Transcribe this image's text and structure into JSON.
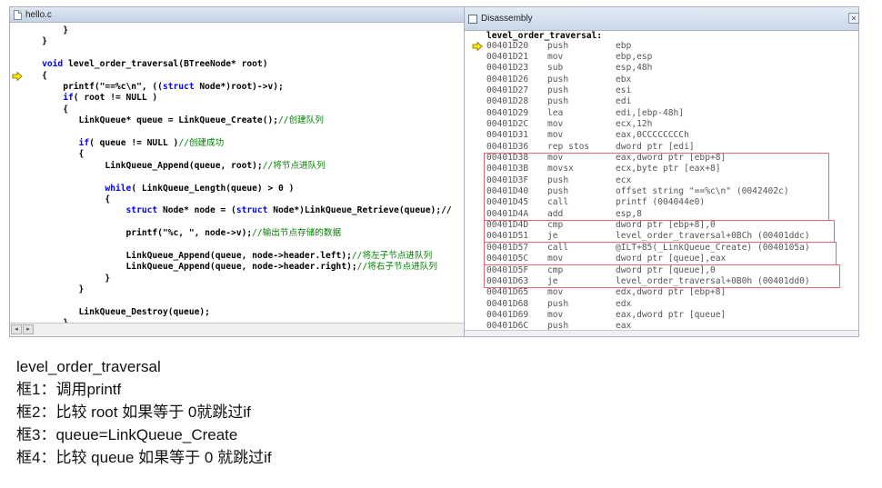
{
  "editor": {
    "title": "hello.c",
    "breakpoint_icon": "yellow-arrow-icon",
    "lines": [
      {
        "segments": [
          {
            "t": "        }",
            "c": "n"
          }
        ]
      },
      {
        "segments": [
          {
            "t": "    }",
            "c": "n"
          }
        ]
      },
      {
        "segments": [
          {
            "t": "",
            "c": "n"
          }
        ]
      },
      {
        "segments": [
          {
            "t": "    ",
            "c": "n"
          },
          {
            "t": "void",
            "c": "kw"
          },
          {
            "t": " level_order_traversal(BTreeNode* root)",
            "c": "n"
          }
        ]
      },
      {
        "segments": [
          {
            "t": "    {",
            "c": "n"
          }
        ],
        "arrow": true
      },
      {
        "segments": [
          {
            "t": "        printf(\"==%c\\n\", ((",
            "c": "n"
          },
          {
            "t": "struct",
            "c": "kw"
          },
          {
            "t": " Node*)root)->v);",
            "c": "n"
          }
        ]
      },
      {
        "segments": [
          {
            "t": "        ",
            "c": "n"
          },
          {
            "t": "if",
            "c": "kw"
          },
          {
            "t": "( root != NULL )",
            "c": "n"
          }
        ]
      },
      {
        "segments": [
          {
            "t": "        {",
            "c": "n"
          }
        ]
      },
      {
        "segments": [
          {
            "t": "           LinkQueue* queue = LinkQueue_Create();",
            "c": "n"
          },
          {
            "t": "//创建队列",
            "c": "cm"
          }
        ]
      },
      {
        "segments": [
          {
            "t": "",
            "c": "n"
          }
        ]
      },
      {
        "segments": [
          {
            "t": "           ",
            "c": "n"
          },
          {
            "t": "if",
            "c": "kw"
          },
          {
            "t": "( queue != NULL )",
            "c": "n"
          },
          {
            "t": "//创建成功",
            "c": "cm"
          }
        ]
      },
      {
        "segments": [
          {
            "t": "           {",
            "c": "n"
          }
        ]
      },
      {
        "segments": [
          {
            "t": "                LinkQueue_Append(queue, root);",
            "c": "n"
          },
          {
            "t": "//将节点进队列",
            "c": "cm"
          }
        ]
      },
      {
        "segments": [
          {
            "t": "",
            "c": "n"
          }
        ]
      },
      {
        "segments": [
          {
            "t": "                ",
            "c": "n"
          },
          {
            "t": "while",
            "c": "kw"
          },
          {
            "t": "( LinkQueue_Length(queue) > 0 )",
            "c": "n"
          }
        ]
      },
      {
        "segments": [
          {
            "t": "                {",
            "c": "n"
          }
        ]
      },
      {
        "segments": [
          {
            "t": "                    ",
            "c": "n"
          },
          {
            "t": "struct",
            "c": "kw"
          },
          {
            "t": " Node* node = (",
            "c": "n"
          },
          {
            "t": "struct",
            "c": "kw"
          },
          {
            "t": " Node*)LinkQueue_Retrieve(queue);//",
            "c": "n"
          }
        ]
      },
      {
        "segments": [
          {
            "t": "",
            "c": "n"
          }
        ]
      },
      {
        "segments": [
          {
            "t": "                    printf(\"%c, \", node->v);",
            "c": "n"
          },
          {
            "t": "//输出节点存储的数据",
            "c": "cm"
          }
        ]
      },
      {
        "segments": [
          {
            "t": "",
            "c": "n"
          }
        ]
      },
      {
        "segments": [
          {
            "t": "                    LinkQueue_Append(queue, node->header.left);",
            "c": "n"
          },
          {
            "t": "//将左子节点进队列",
            "c": "cm"
          }
        ]
      },
      {
        "segments": [
          {
            "t": "                    LinkQueue_Append(queue, node->header.right);",
            "c": "n"
          },
          {
            "t": "//将右子节点进队列",
            "c": "cm"
          }
        ]
      },
      {
        "segments": [
          {
            "t": "                }",
            "c": "n"
          }
        ]
      },
      {
        "segments": [
          {
            "t": "           }",
            "c": "n"
          }
        ]
      },
      {
        "segments": [
          {
            "t": "",
            "c": "n"
          }
        ]
      },
      {
        "segments": [
          {
            "t": "           LinkQueue_Destroy(queue);",
            "c": "n"
          }
        ]
      },
      {
        "segments": [
          {
            "t": "        }",
            "c": "n"
          }
        ]
      }
    ]
  },
  "disassembly": {
    "title": "Disassembly",
    "close_glyph": "×",
    "header": "level_order_traversal:",
    "rows": [
      {
        "addr": "00401D20",
        "mn": "push",
        "op": "ebp",
        "arrow": true
      },
      {
        "addr": "00401D21",
        "mn": "mov",
        "op": "ebp,esp"
      },
      {
        "addr": "00401D23",
        "mn": "sub",
        "op": "esp,48h"
      },
      {
        "addr": "00401D26",
        "mn": "push",
        "op": "ebx"
      },
      {
        "addr": "00401D27",
        "mn": "push",
        "op": "esi"
      },
      {
        "addr": "00401D28",
        "mn": "push",
        "op": "edi"
      },
      {
        "addr": "00401D29",
        "mn": "lea",
        "op": "edi,[ebp-48h]"
      },
      {
        "addr": "00401D2C",
        "mn": "mov",
        "op": "ecx,12h"
      },
      {
        "addr": "00401D31",
        "mn": "mov",
        "op": "eax,0CCCCCCCCh"
      },
      {
        "addr": "00401D36",
        "mn": "rep stos",
        "op": "dword ptr [edi]"
      },
      {
        "addr": "00401D38",
        "mn": "mov",
        "op": "eax,dword ptr [ebp+8]"
      },
      {
        "addr": "00401D3B",
        "mn": "movsx",
        "op": "ecx,byte ptr [eax+8]"
      },
      {
        "addr": "00401D3F",
        "mn": "push",
        "op": "ecx"
      },
      {
        "addr": "00401D40",
        "mn": "push",
        "op": "offset string \"==%c\\n\" (0042402c)"
      },
      {
        "addr": "00401D45",
        "mn": "call",
        "op": "printf (004044e0)"
      },
      {
        "addr": "00401D4A",
        "mn": "add",
        "op": "esp,8"
      },
      {
        "addr": "00401D4D",
        "mn": "cmp",
        "op": "dword ptr [ebp+8],0"
      },
      {
        "addr": "00401D51",
        "mn": "je",
        "op": "level_order_traversal+0BCh (00401ddc)"
      },
      {
        "addr": "00401D57",
        "mn": "call",
        "op": "@ILT+85(_LinkQueue_Create) (0040105a)"
      },
      {
        "addr": "00401D5C",
        "mn": "mov",
        "op": "dword ptr [queue],eax"
      },
      {
        "addr": "00401D5F",
        "mn": "cmp",
        "op": "dword ptr [queue],0"
      },
      {
        "addr": "00401D63",
        "mn": "je",
        "op": "level_order_traversal+0B0h (00401dd0)"
      },
      {
        "addr": "00401D65",
        "mn": "mov",
        "op": "edx,dword ptr [ebp+8]"
      },
      {
        "addr": "00401D68",
        "mn": "push",
        "op": "edx"
      },
      {
        "addr": "00401D69",
        "mn": "mov",
        "op": "eax,dword ptr [queue]"
      },
      {
        "addr": "00401D6C",
        "mn": "push",
        "op": "eax"
      }
    ],
    "highlight_color": "#e06a74"
  },
  "notes": [
    "level_order_traversal",
    "框1：调用printf",
    "框2：比较 root 如果等于 0就跳过if",
    "框3：queue=LinkQueue_Create",
    "框4：比较 queue 如果等于 0 就跳过if"
  ]
}
